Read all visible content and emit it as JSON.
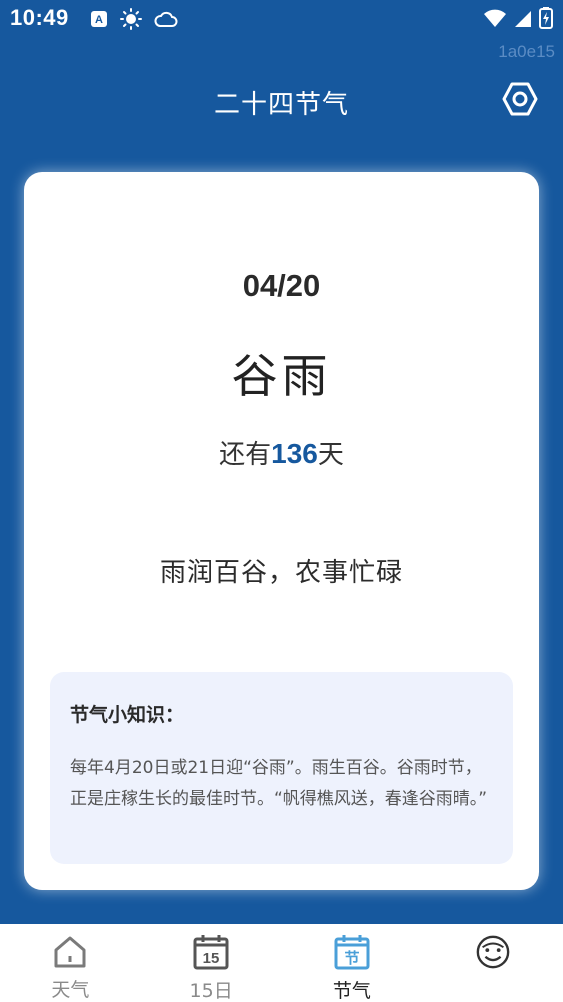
{
  "status_bar": {
    "time": "10:49",
    "icons_left": [
      "a-badge-icon",
      "sun-icon",
      "cloud-icon"
    ],
    "icons_right": [
      "wifi-icon",
      "signal-icon",
      "battery-icon"
    ]
  },
  "build_tag": "1a0e15",
  "app_bar": {
    "title": "二十四节气",
    "settings_icon": "settings-icon"
  },
  "solar_term": {
    "date": "04/20",
    "name": "谷雨",
    "countdown_prefix": "还有",
    "days_left": "136",
    "countdown_suffix": "天",
    "motto": "雨润百谷，农事忙碌"
  },
  "tips": {
    "title": "节气小知识：",
    "body": "每年4月20日或21日迎“谷雨”。雨生百谷。谷雨时节，正是庄稼生长的最佳时节。“帆得樵风送，春逢谷雨晴。”"
  },
  "bottom_nav": {
    "items": [
      {
        "label": "天气",
        "icon": "home-icon",
        "active": false
      },
      {
        "label": "15日",
        "icon": "calendar-15-icon",
        "active": false
      },
      {
        "label": "节气",
        "icon": "solar-term-icon",
        "active": true
      },
      {
        "label": "",
        "icon": "smiley-face-icon",
        "active": false
      }
    ]
  },
  "colors": {
    "brand_blue": "#16589e",
    "card_bg": "#ffffff",
    "tips_bg": "#eef2fd",
    "inactive_nav": "#8a8a8a"
  }
}
